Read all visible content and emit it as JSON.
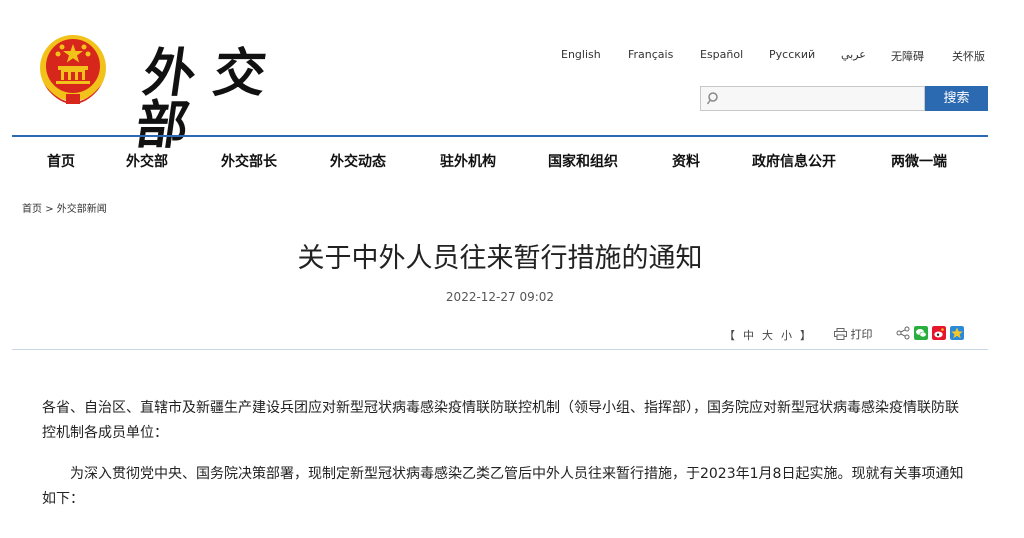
{
  "header": {
    "emblem_icon": "national-emblem-icon",
    "logo_text": "外交部",
    "languages": [
      "English",
      "Français",
      "Español",
      "Русский",
      "عربي",
      "无障碍",
      "关怀版"
    ],
    "search": {
      "placeholder": "",
      "button_label": "搜索",
      "icon": "search-icon"
    }
  },
  "nav": {
    "items": [
      "首页",
      "外交部",
      "外交部长",
      "外交动态",
      "驻外机构",
      "国家和组织",
      "资料",
      "政府信息公开",
      "两微一端"
    ]
  },
  "breadcrumb": {
    "home": "首页",
    "separator": ">",
    "current": "外交部新闻"
  },
  "article": {
    "title": "关于中外人员往来暂行措施的通知",
    "date": "2022-12-27 09:02",
    "font_size": {
      "open": "【",
      "large": "中",
      "medium": "大",
      "small": "小",
      "close": "】"
    },
    "print_label": "打印",
    "share_icons": [
      "share-icon",
      "wechat-icon",
      "weibo-icon",
      "qzone-icon"
    ],
    "paragraphs": [
      "各省、自治区、直辖市及新疆生产建设兵团应对新型冠状病毒感染疫情联防联控机制（领导小组、指挥部），国务院应对新型冠状病毒感染疫情联防联控机制各成员单位：",
      "为深入贯彻党中央、国务院决策部署，现制定新型冠状病毒感染乙类乙管后中外人员往来暂行措施，于2023年1月8日起实施。现就有关事项通知如下："
    ]
  },
  "colors": {
    "accent": "#2b69b1",
    "emblem_red": "#d7261b",
    "emblem_gold": "#f2c21a"
  }
}
